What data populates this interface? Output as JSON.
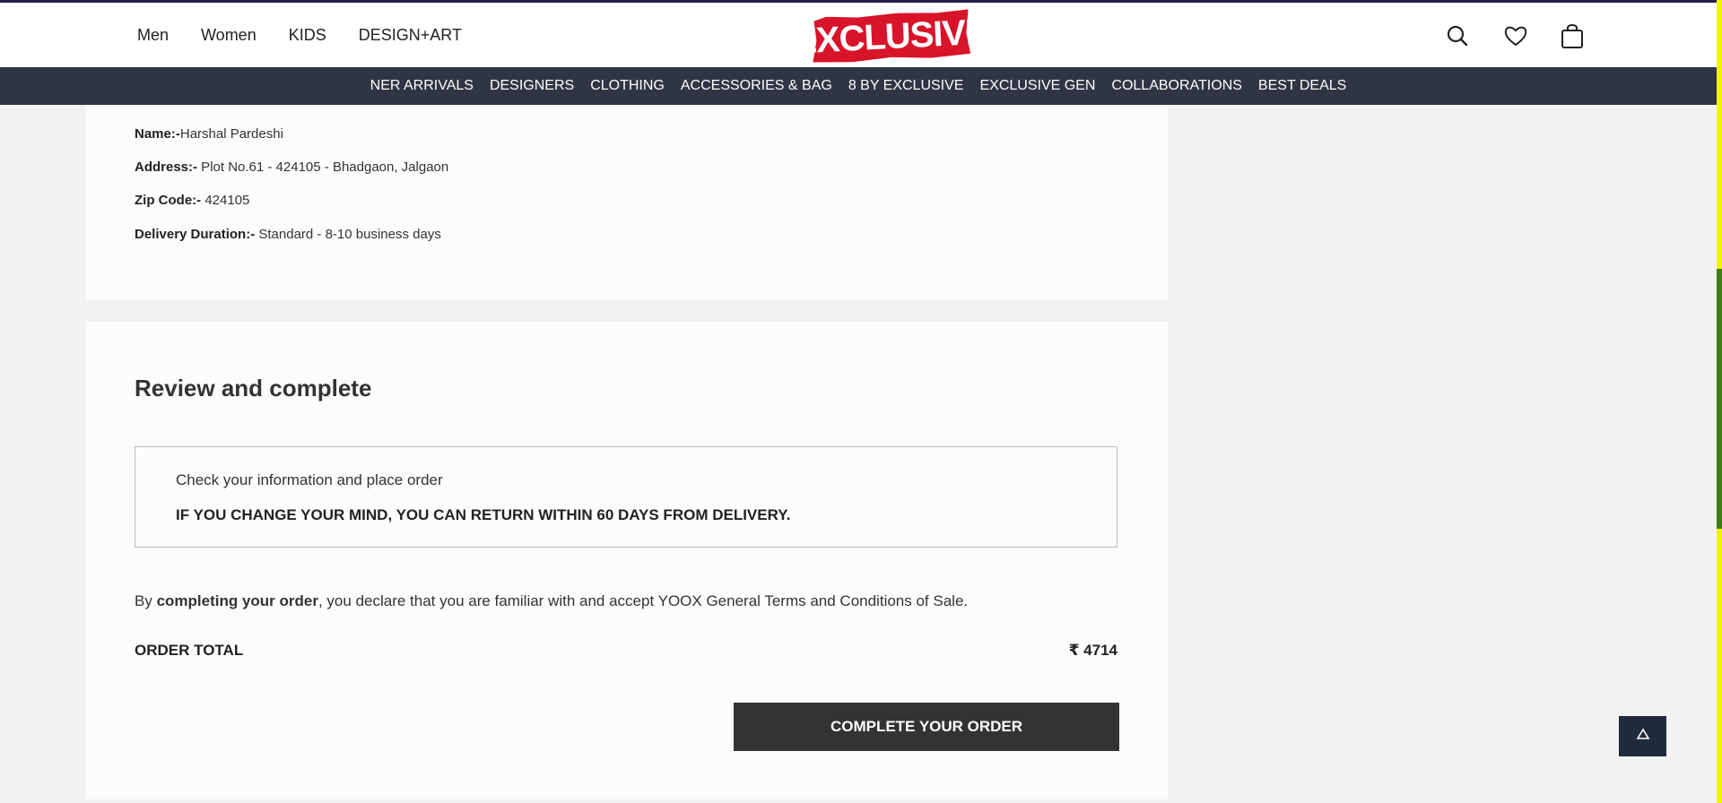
{
  "header": {
    "nav": [
      "Men",
      "Women",
      "KIDS",
      "DESIGN+ART"
    ],
    "logo_text": "EXCLUSIVE",
    "icons": [
      "search-icon",
      "heart-icon",
      "shopping-bag-icon"
    ]
  },
  "category_bar": {
    "items": [
      "NER ARRIVALS",
      "DESIGNERS",
      "CLOTHING",
      "ACCESSORIES & BAG",
      "8 BY EXCLUSIVE",
      "EXCLUSIVE GEN",
      "COLLABORATIONS",
      "BEST DEALS"
    ]
  },
  "billing": {
    "name_label": "Name:-",
    "name_value": "Harshal Pardeshi",
    "address_label": "Address:-",
    "address_value": " Plot No.61 - 424105 - Bhadgaon, Jalgaon",
    "zip_label": "Zip Code:-",
    "zip_value": " 424105",
    "delivery_label": "Delivery Duration:-",
    "delivery_value": " Standard - 8-10 business days"
  },
  "review": {
    "title": "Review and complete",
    "check_text": "Check your information and place order",
    "return_text": "IF YOU CHANGE YOUR MIND, YOU CAN RETURN WITHIN 60 DAYS FROM DELIVERY.",
    "terms_prefix": "By ",
    "terms_bold": "completing your order",
    "terms_suffix": ", you declare that you are familiar with and accept YOOX General Terms and Conditions of Sale.",
    "total_label": "ORDER TOTAL",
    "total_value": "₹ 4714",
    "complete_button": "COMPLETE YOUR ORDER"
  },
  "colors": {
    "category_bar_bg": "#2f3542",
    "logo_red": "#d8142a",
    "button_bg": "#333333"
  }
}
